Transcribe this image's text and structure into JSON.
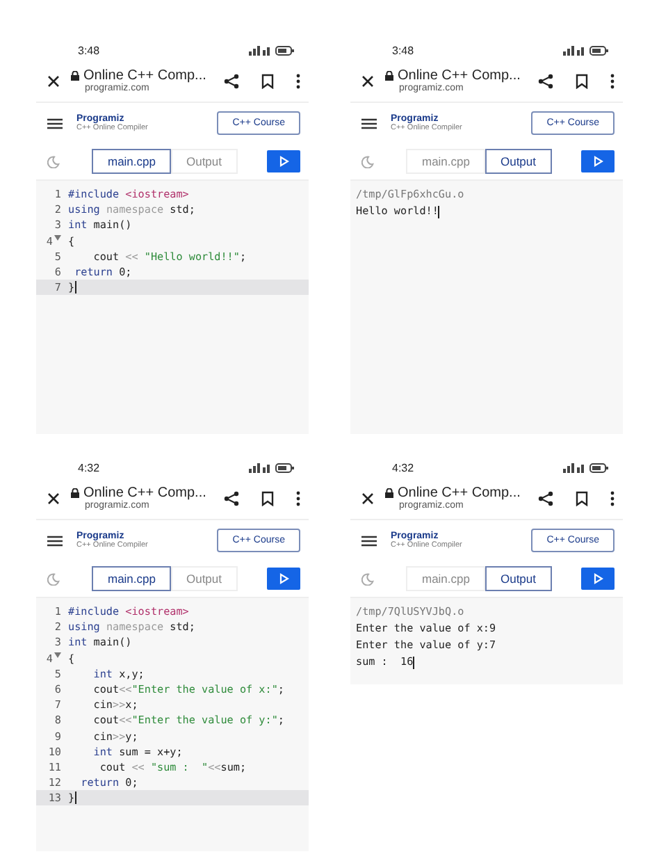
{
  "screens": [
    {
      "time": "3:48",
      "title": "Online C++ Comp...",
      "url": "programiz.com",
      "logo": "Programiz",
      "subtitle": "C++ Online Compiler",
      "course_button": "C++ Course",
      "tabs": [
        {
          "label": "main.cpp",
          "selected": true
        },
        {
          "label": "Output",
          "selected": false
        }
      ],
      "kind": "editor",
      "lines": [
        {
          "number": "1",
          "fold": false,
          "active": false,
          "tokens": [
            {
              "text": "#include ",
              "kind": "keyword"
            },
            {
              "text": "<iostream>",
              "kind": "include"
            }
          ]
        },
        {
          "number": "2",
          "fold": false,
          "active": false,
          "tokens": [
            {
              "text": "using ",
              "kind": "keyword"
            },
            {
              "text": "namespace ",
              "kind": "muted"
            },
            {
              "text": "std;",
              "kind": "plain"
            }
          ]
        },
        {
          "number": "3",
          "fold": false,
          "active": false,
          "tokens": [
            {
              "text": "int ",
              "kind": "keyword"
            },
            {
              "text": "main()",
              "kind": "plain"
            }
          ]
        },
        {
          "number": "4",
          "fold": true,
          "active": false,
          "tokens": [
            {
              "text": "{",
              "kind": "plain"
            }
          ]
        },
        {
          "number": "5",
          "fold": false,
          "active": false,
          "tokens": [
            {
              "text": "    cout ",
              "kind": "plain"
            },
            {
              "text": "<< ",
              "kind": "muted"
            },
            {
              "text": "\"Hello world!!\"",
              "kind": "string"
            },
            {
              "text": ";",
              "kind": "plain"
            }
          ]
        },
        {
          "number": "6",
          "fold": false,
          "active": false,
          "tokens": [
            {
              "text": " return ",
              "kind": "keyword"
            },
            {
              "text": "0;",
              "kind": "plain"
            }
          ]
        },
        {
          "number": "7",
          "fold": false,
          "active": true,
          "tokens": [
            {
              "text": "}",
              "kind": "plain"
            }
          ]
        }
      ]
    },
    {
      "time": "3:48",
      "title": "Online C++ Comp...",
      "url": "programiz.com",
      "logo": "Programiz",
      "subtitle": "C++ Online Compiler",
      "course_button": "C++ Course",
      "tabs": [
        {
          "label": "main.cpp",
          "selected": false
        },
        {
          "label": "Output",
          "selected": true
        }
      ],
      "kind": "output",
      "output": [
        {
          "text": "/tmp/GlFp6xhcGu.o",
          "kind": "path"
        },
        {
          "text": "Hello world!!",
          "kind": "text"
        }
      ]
    },
    {
      "time": "4:32",
      "title": "Online C++ Comp...",
      "url": "programiz.com",
      "logo": "Programiz",
      "subtitle": "C++ Online Compiler",
      "course_button": "C++ Course",
      "tabs": [
        {
          "label": "main.cpp",
          "selected": true
        },
        {
          "label": "Output",
          "selected": false
        }
      ],
      "kind": "editor",
      "lines": [
        {
          "number": "1",
          "fold": false,
          "active": false,
          "tokens": [
            {
              "text": "#include ",
              "kind": "keyword"
            },
            {
              "text": "<iostream>",
              "kind": "include"
            }
          ]
        },
        {
          "number": "2",
          "fold": false,
          "active": false,
          "tokens": [
            {
              "text": "using ",
              "kind": "keyword"
            },
            {
              "text": "namespace ",
              "kind": "muted"
            },
            {
              "text": "std;",
              "kind": "plain"
            }
          ]
        },
        {
          "number": "3",
          "fold": false,
          "active": false,
          "tokens": [
            {
              "text": "int ",
              "kind": "keyword"
            },
            {
              "text": "main()",
              "kind": "plain"
            }
          ]
        },
        {
          "number": "4",
          "fold": true,
          "active": false,
          "tokens": [
            {
              "text": "{",
              "kind": "plain"
            }
          ]
        },
        {
          "number": "5",
          "fold": false,
          "active": false,
          "tokens": [
            {
              "text": "    int ",
              "kind": "keyword"
            },
            {
              "text": "x,y;",
              "kind": "plain"
            }
          ]
        },
        {
          "number": "6",
          "fold": false,
          "active": false,
          "tokens": [
            {
              "text": "    cout",
              "kind": "plain"
            },
            {
              "text": "<<",
              "kind": "muted"
            },
            {
              "text": "\"Enter the value of x:\"",
              "kind": "string"
            },
            {
              "text": ";",
              "kind": "plain"
            }
          ]
        },
        {
          "number": "7",
          "fold": false,
          "active": false,
          "tokens": [
            {
              "text": "    cin",
              "kind": "plain"
            },
            {
              "text": ">>",
              "kind": "muted"
            },
            {
              "text": "x;",
              "kind": "plain"
            }
          ]
        },
        {
          "number": "8",
          "fold": false,
          "active": false,
          "tokens": [
            {
              "text": "    cout",
              "kind": "plain"
            },
            {
              "text": "<<",
              "kind": "muted"
            },
            {
              "text": "\"Enter the value of y:\"",
              "kind": "string"
            },
            {
              "text": ";",
              "kind": "plain"
            }
          ]
        },
        {
          "number": "9",
          "fold": false,
          "active": false,
          "tokens": [
            {
              "text": "    cin",
              "kind": "plain"
            },
            {
              "text": ">>",
              "kind": "muted"
            },
            {
              "text": "y;",
              "kind": "plain"
            }
          ]
        },
        {
          "number": "10",
          "fold": false,
          "active": false,
          "tokens": [
            {
              "text": "    int ",
              "kind": "keyword"
            },
            {
              "text": "sum = x+y;",
              "kind": "plain"
            }
          ]
        },
        {
          "number": "11",
          "fold": false,
          "active": false,
          "tokens": [
            {
              "text": "     cout ",
              "kind": "plain"
            },
            {
              "text": "<< ",
              "kind": "muted"
            },
            {
              "text": "\"sum :  \"",
              "kind": "string"
            },
            {
              "text": "<<",
              "kind": "muted"
            },
            {
              "text": "sum;",
              "kind": "plain"
            }
          ]
        },
        {
          "number": "12",
          "fold": false,
          "active": false,
          "tokens": [
            {
              "text": "  return ",
              "kind": "keyword"
            },
            {
              "text": "0;",
              "kind": "plain"
            }
          ]
        },
        {
          "number": "13",
          "fold": false,
          "active": true,
          "tokens": [
            {
              "text": "}",
              "kind": "plain"
            }
          ]
        }
      ]
    },
    {
      "time": "4:32",
      "title": "Online C++ Comp...",
      "url": "programiz.com",
      "logo": "Programiz",
      "subtitle": "C++ Online Compiler",
      "course_button": "C++ Course",
      "tabs": [
        {
          "label": "main.cpp",
          "selected": false
        },
        {
          "label": "Output",
          "selected": true
        }
      ],
      "kind": "output",
      "output": [
        {
          "text": "/tmp/7QlUSYVJbQ.o",
          "kind": "path"
        },
        {
          "text": "Enter the value of x:9",
          "kind": "text"
        },
        {
          "text": "Enter the value of y:7",
          "kind": "text"
        },
        {
          "text": "sum :  16",
          "kind": "text"
        }
      ]
    }
  ]
}
